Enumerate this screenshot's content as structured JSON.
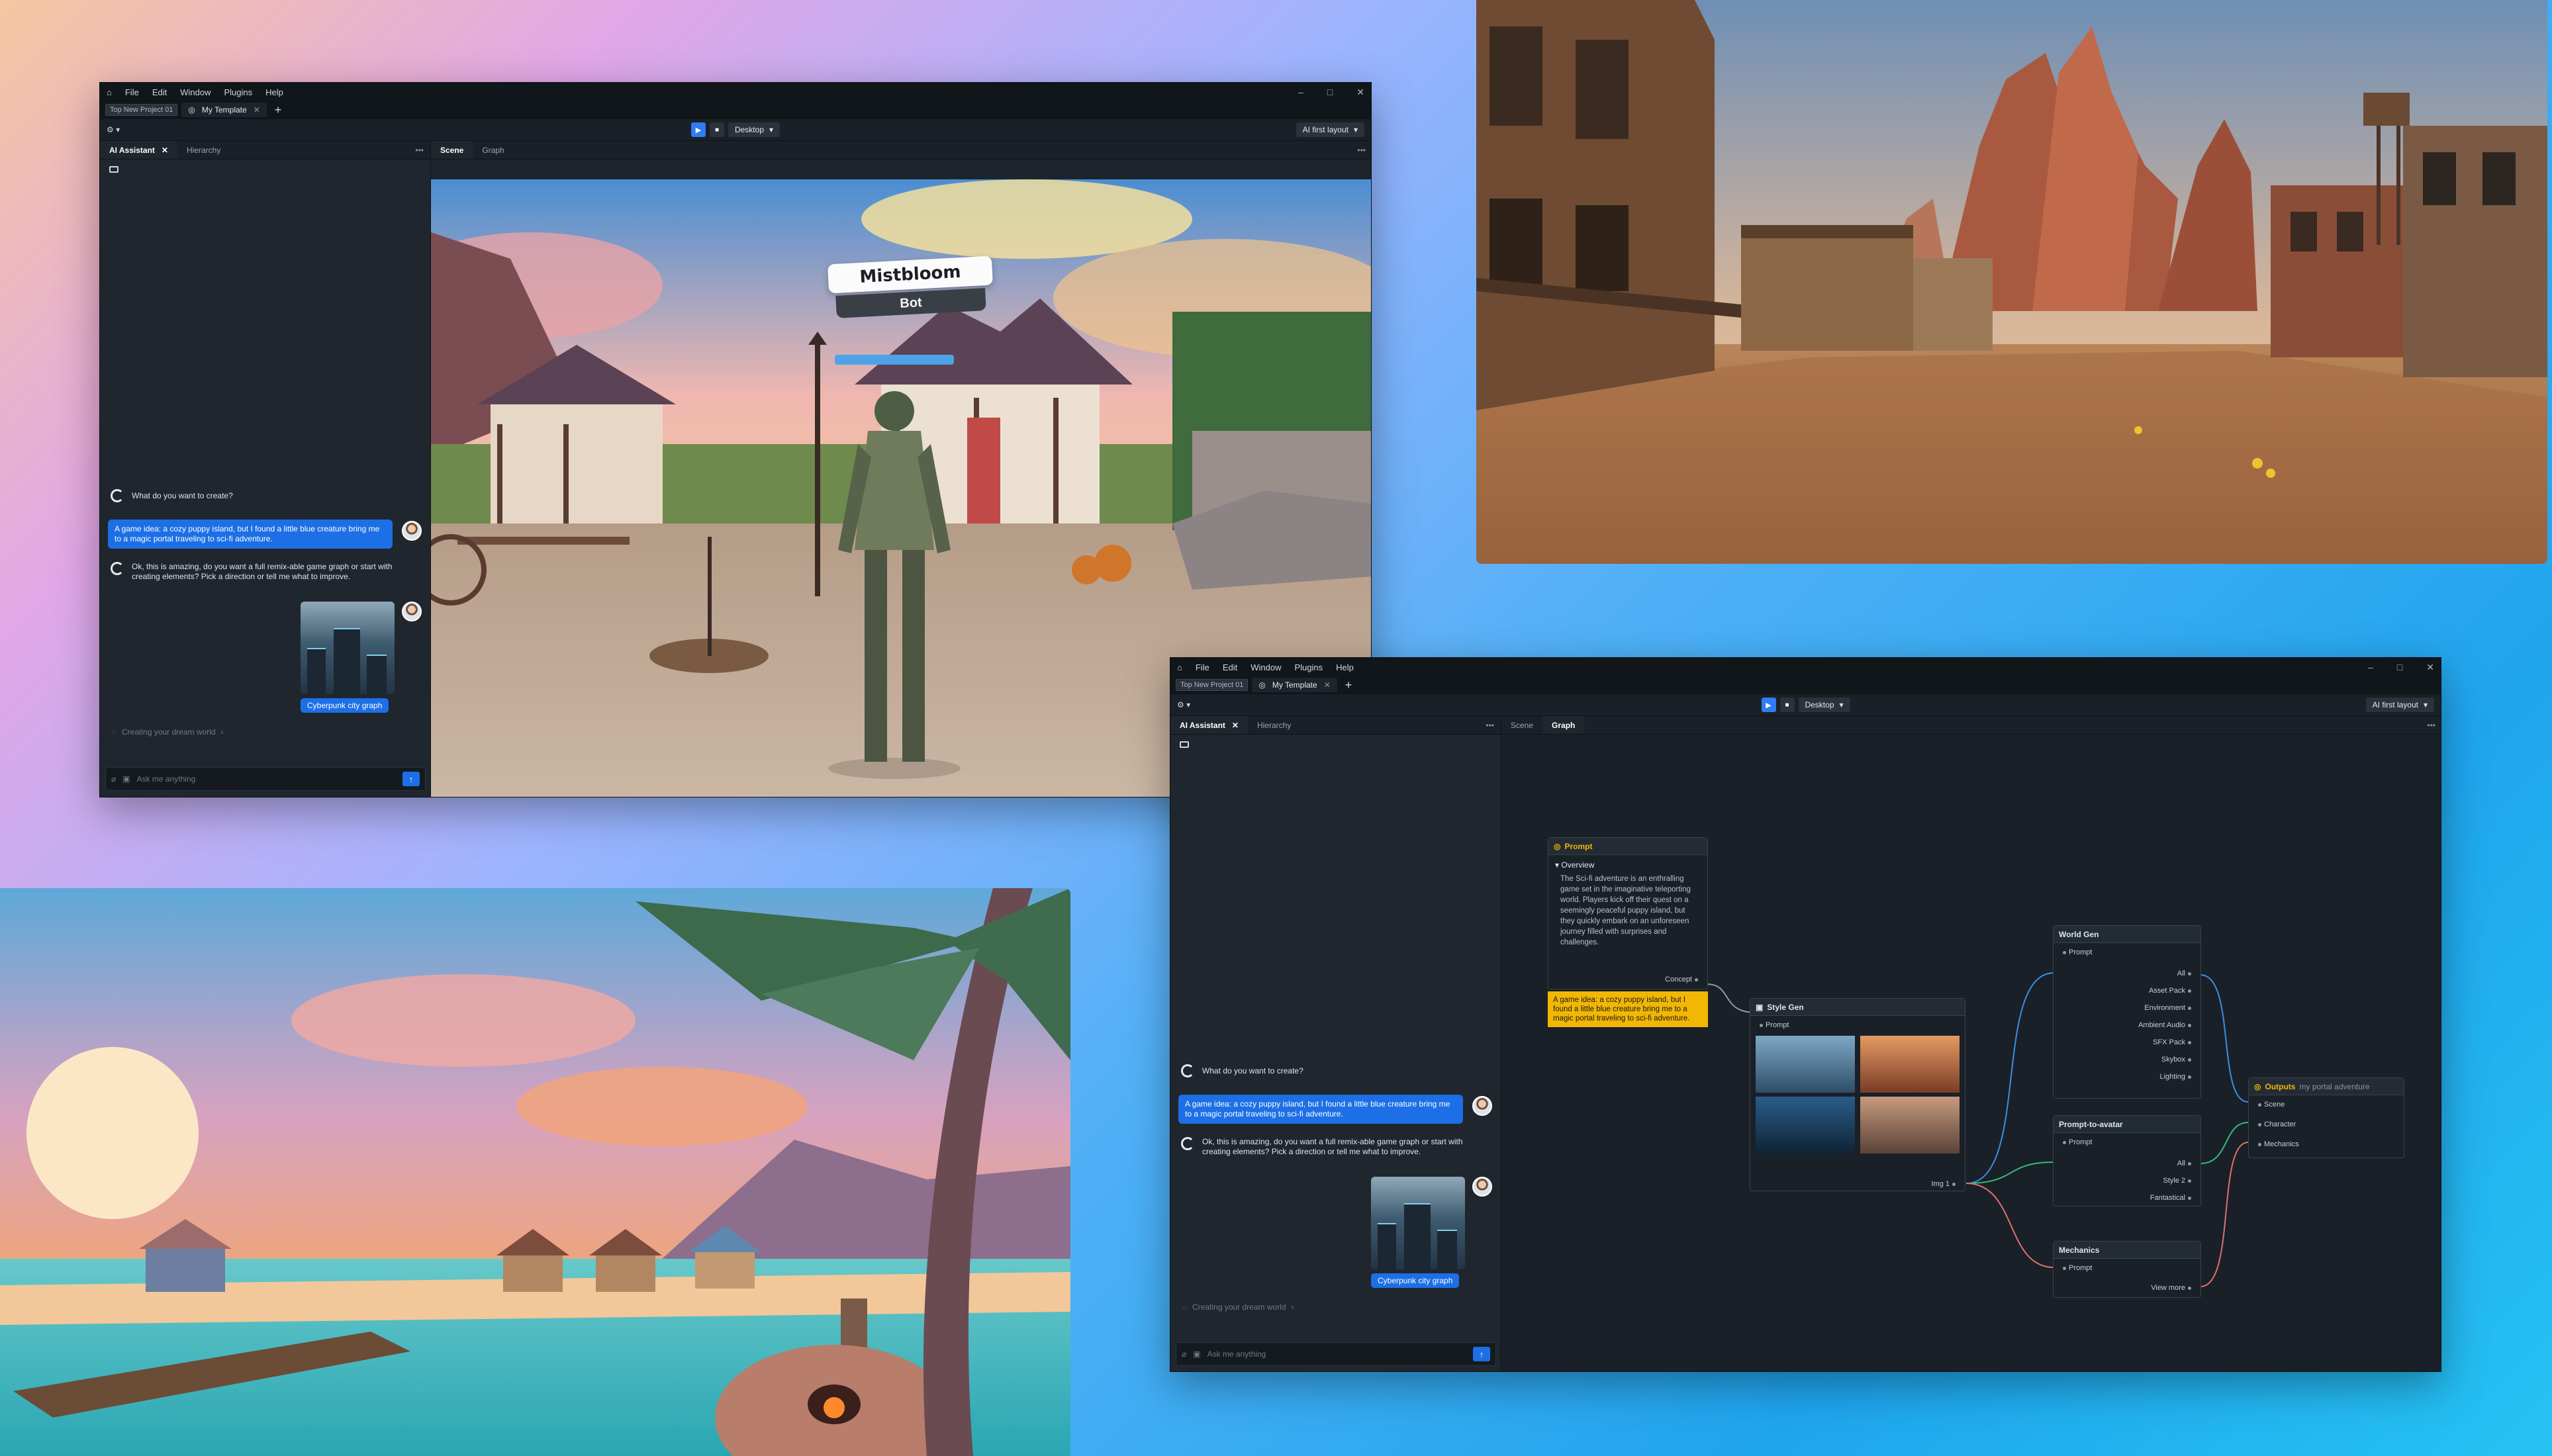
{
  "menu": [
    "File",
    "Edit",
    "Window",
    "Plugins",
    "Help"
  ],
  "tabs": {
    "project": "Top New Project 01",
    "doc": "My Template"
  },
  "toolbar": {
    "platform": "Desktop",
    "layout": "AI first layout"
  },
  "panels": {
    "ai": "AI Assistant",
    "hierarchy": "Hierarchy",
    "scene": "Scene",
    "graph": "Graph"
  },
  "chat": {
    "prompt": "What do you want to create?",
    "user": "A game idea: a cozy puppy island, but I found a little blue creature bring me to a magic portal traveling to sci-fi adventure.",
    "reply": "Ok, this is amazing, do you want a full remix-able game graph or start with creating elements? Pick a direction or tell me what to improve.",
    "chip": "Cyberpunk city graph",
    "status": "Creating your dream world",
    "placeholder": "Ask me anything"
  },
  "scene": {
    "npc_name": "Mistbloom",
    "npc_tag": "Bot"
  },
  "graph": {
    "prompt_node": {
      "title": "Prompt",
      "section": "Overview",
      "body": "The Sci-fi adventure is an enthralling game set in the imaginative teleporting world. Players kick off their quest on a seemingly peaceful puppy island, but they quickly embark on an unforeseen journey filled with surprises and challenges.",
      "port": "Concept",
      "note": "A game idea: a cozy puppy island, but I found a little blue creature bring me to a magic portal traveling to sci-fi adventure."
    },
    "style_node": {
      "title": "Style Gen",
      "input": "Prompt",
      "output": "Img 1"
    },
    "world_node": {
      "title": "World Gen",
      "input": "Prompt",
      "outputs": [
        "All",
        "Asset Pack",
        "Environment",
        "Ambient Audio",
        "SFX Pack",
        "Skybox",
        "Lighting"
      ]
    },
    "avatar_node": {
      "title": "Prompt-to-avatar",
      "input": "Prompt",
      "outputs": [
        "All",
        "Style 2",
        "Fantastical"
      ]
    },
    "mech_node": {
      "title": "Mechanics",
      "input": "Prompt",
      "output": "View more"
    },
    "out_node": {
      "title": "Outputs",
      "subtitle": "my portal adventure",
      "items": [
        "Scene",
        "Character",
        "Mechanics"
      ]
    }
  },
  "colors": {
    "accent": "#1d6fe6",
    "note": "#f2b705",
    "wire_blue": "#3a8ee6",
    "wire_green": "#2fbf7a",
    "wire_red": "#e0706f"
  }
}
